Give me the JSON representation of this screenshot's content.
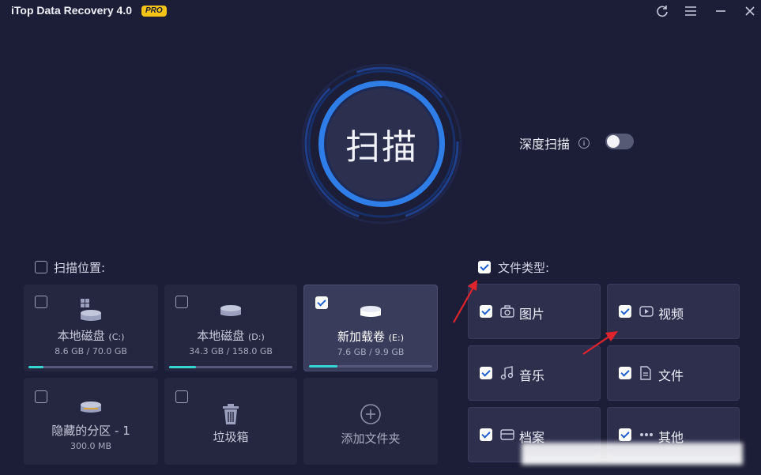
{
  "app": {
    "title": "iTop Data Recovery 4.0",
    "badge": "PRO"
  },
  "scan": {
    "button_label": "扫描",
    "deep_scan_label": "深度扫描",
    "deep_scan_info": "i",
    "deep_scan_enabled": false
  },
  "locations": {
    "header": "扫描位置:",
    "items": [
      {
        "name": "本地磁盘",
        "letter": "(C:)",
        "size": "8.6 GB / 70.0 GB",
        "checked": false,
        "usage": 0.12,
        "icon": "windows-drive-icon"
      },
      {
        "name": "本地磁盘",
        "letter": "(D:)",
        "size": "34.3 GB / 158.0 GB",
        "checked": false,
        "usage": 0.22,
        "icon": "hard-drive-icon"
      },
      {
        "name": "新加载卷",
        "letter": "(E:)",
        "size": "7.6 GB / 9.9 GB",
        "checked": true,
        "usage": 0.23,
        "icon": "hard-drive-icon"
      },
      {
        "name": "隐藏的分区 - 1",
        "size": "300.0 MB",
        "checked": false,
        "icon": "hidden-drive-icon"
      },
      {
        "name": "垃圾箱",
        "checked": false,
        "icon": "trash-icon"
      },
      {
        "name": "添加文件夹",
        "icon": "add-folder-icon"
      }
    ]
  },
  "file_types": {
    "header": "文件类型:",
    "header_checked": true,
    "items": [
      {
        "label": "图片",
        "checked": true,
        "icon": "camera-icon"
      },
      {
        "label": "视频",
        "checked": true,
        "icon": "video-icon"
      },
      {
        "label": "音乐",
        "checked": true,
        "icon": "music-icon"
      },
      {
        "label": "文件",
        "checked": true,
        "icon": "document-icon"
      },
      {
        "label": "档案",
        "checked": true,
        "icon": "archive-icon"
      },
      {
        "label": "其他",
        "checked": true,
        "icon": "other-icon"
      }
    ]
  },
  "colors": {
    "background": "#1c1d36",
    "accent": "#2f7ee8",
    "pro": "#f4c316",
    "usage": "#33d6d1",
    "arrow": "#e0242b"
  }
}
